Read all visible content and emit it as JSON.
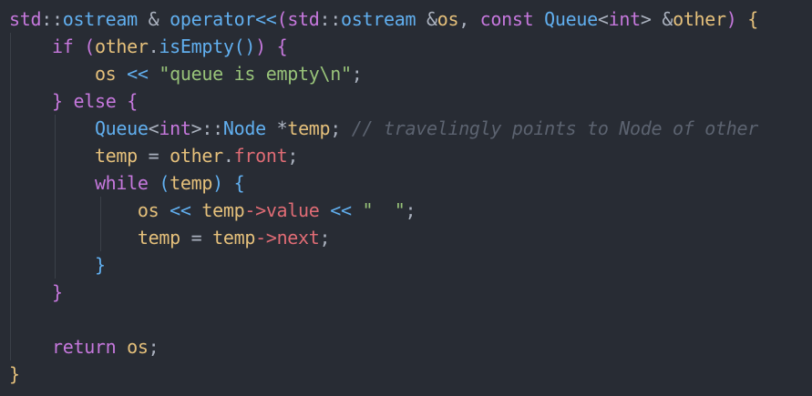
{
  "colors": {
    "background": "#282c34",
    "indent_guide": "#3b4048",
    "plain": "#abb2bf",
    "keyword": "#c678dd",
    "type": "#61afef",
    "variable": "#e5c07b",
    "member": "#e06c75",
    "function": "#61afef",
    "string": "#98c379",
    "comment": "#5c6370",
    "bracket_gold": "#e5c07b",
    "bracket_violet": "#c678dd",
    "bracket_blue": "#61afef"
  },
  "code": {
    "lines": [
      [
        {
          "t": "std",
          "c": "keyword"
        },
        {
          "t": "::",
          "c": "plain"
        },
        {
          "t": "ostream",
          "c": "type"
        },
        {
          "t": " & ",
          "c": "plain"
        },
        {
          "t": "operator<<",
          "c": "function"
        },
        {
          "t": "(",
          "c": "bracket_violet"
        },
        {
          "t": "std",
          "c": "keyword"
        },
        {
          "t": "::",
          "c": "plain"
        },
        {
          "t": "ostream",
          "c": "type"
        },
        {
          "t": " &",
          "c": "plain"
        },
        {
          "t": "os",
          "c": "variable"
        },
        {
          "t": ", ",
          "c": "plain"
        },
        {
          "t": "const",
          "c": "keyword"
        },
        {
          "t": " ",
          "c": "plain"
        },
        {
          "t": "Queue",
          "c": "type"
        },
        {
          "t": "<",
          "c": "plain"
        },
        {
          "t": "int",
          "c": "keyword"
        },
        {
          "t": "> &",
          "c": "plain"
        },
        {
          "t": "other",
          "c": "variable"
        },
        {
          "t": ")",
          "c": "bracket_violet"
        },
        {
          "t": " ",
          "c": "plain"
        },
        {
          "t": "{",
          "c": "bracket_gold"
        }
      ],
      [
        {
          "t": "    ",
          "c": "plain"
        },
        {
          "t": "if",
          "c": "keyword"
        },
        {
          "t": " ",
          "c": "plain"
        },
        {
          "t": "(",
          "c": "bracket_violet"
        },
        {
          "t": "other",
          "c": "variable"
        },
        {
          "t": ".",
          "c": "plain"
        },
        {
          "t": "isEmpty",
          "c": "function"
        },
        {
          "t": "()",
          "c": "bracket_blue"
        },
        {
          "t": ")",
          "c": "bracket_violet"
        },
        {
          "t": " ",
          "c": "plain"
        },
        {
          "t": "{",
          "c": "bracket_violet"
        }
      ],
      [
        {
          "t": "        ",
          "c": "plain"
        },
        {
          "t": "os",
          "c": "variable"
        },
        {
          "t": " << ",
          "c": "function"
        },
        {
          "t": "\"queue is empty\\n\"",
          "c": "string"
        },
        {
          "t": ";",
          "c": "plain"
        }
      ],
      [
        {
          "t": "    ",
          "c": "plain"
        },
        {
          "t": "}",
          "c": "bracket_violet"
        },
        {
          "t": " ",
          "c": "plain"
        },
        {
          "t": "else",
          "c": "keyword"
        },
        {
          "t": " ",
          "c": "plain"
        },
        {
          "t": "{",
          "c": "bracket_violet"
        }
      ],
      [
        {
          "t": "        ",
          "c": "plain"
        },
        {
          "t": "Queue",
          "c": "type"
        },
        {
          "t": "<",
          "c": "plain"
        },
        {
          "t": "int",
          "c": "keyword"
        },
        {
          "t": ">::",
          "c": "plain"
        },
        {
          "t": "Node",
          "c": "type"
        },
        {
          "t": " *",
          "c": "plain"
        },
        {
          "t": "temp",
          "c": "variable"
        },
        {
          "t": "; ",
          "c": "plain"
        },
        {
          "t": "// travelingly points to Node of other",
          "c": "comment"
        }
      ],
      [
        {
          "t": "        ",
          "c": "plain"
        },
        {
          "t": "temp",
          "c": "variable"
        },
        {
          "t": " = ",
          "c": "plain"
        },
        {
          "t": "other",
          "c": "variable"
        },
        {
          "t": ".",
          "c": "plain"
        },
        {
          "t": "front",
          "c": "member"
        },
        {
          "t": ";",
          "c": "plain"
        }
      ],
      [
        {
          "t": "        ",
          "c": "plain"
        },
        {
          "t": "while",
          "c": "keyword"
        },
        {
          "t": " ",
          "c": "plain"
        },
        {
          "t": "(",
          "c": "bracket_blue"
        },
        {
          "t": "temp",
          "c": "variable"
        },
        {
          "t": ")",
          "c": "bracket_blue"
        },
        {
          "t": " ",
          "c": "plain"
        },
        {
          "t": "{",
          "c": "bracket_blue"
        }
      ],
      [
        {
          "t": "            ",
          "c": "plain"
        },
        {
          "t": "os",
          "c": "variable"
        },
        {
          "t": " << ",
          "c": "function"
        },
        {
          "t": "temp",
          "c": "variable"
        },
        {
          "t": "->",
          "c": "member"
        },
        {
          "t": "value",
          "c": "member"
        },
        {
          "t": " << ",
          "c": "function"
        },
        {
          "t": "\"  \"",
          "c": "string"
        },
        {
          "t": ";",
          "c": "plain"
        }
      ],
      [
        {
          "t": "            ",
          "c": "plain"
        },
        {
          "t": "temp",
          "c": "variable"
        },
        {
          "t": " = ",
          "c": "plain"
        },
        {
          "t": "temp",
          "c": "variable"
        },
        {
          "t": "->",
          "c": "member"
        },
        {
          "t": "next",
          "c": "member"
        },
        {
          "t": ";",
          "c": "plain"
        }
      ],
      [
        {
          "t": "        ",
          "c": "plain"
        },
        {
          "t": "}",
          "c": "bracket_blue"
        }
      ],
      [
        {
          "t": "    ",
          "c": "plain"
        },
        {
          "t": "}",
          "c": "bracket_violet"
        }
      ],
      [],
      [
        {
          "t": "    ",
          "c": "plain"
        },
        {
          "t": "return",
          "c": "keyword"
        },
        {
          "t": " ",
          "c": "plain"
        },
        {
          "t": "os",
          "c": "variable"
        },
        {
          "t": ";",
          "c": "plain"
        }
      ],
      [
        {
          "t": "}",
          "c": "bracket_gold"
        }
      ]
    ]
  }
}
